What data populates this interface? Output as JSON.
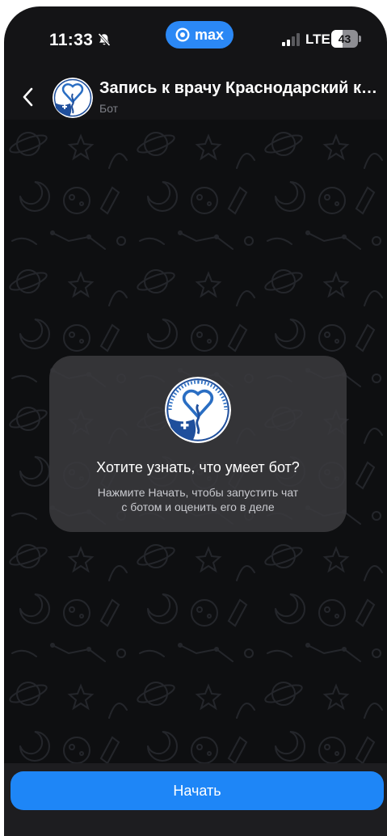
{
  "status_bar": {
    "time": "11:33",
    "bell_icon": "bell-slash-icon",
    "app_pill_label": "max",
    "app_pill_icon": "max-logo-icon",
    "network": "LTE",
    "battery": "43",
    "battery_level_percent": 43
  },
  "header": {
    "back_icon": "chevron-left-icon",
    "title": "Запись к врачу Краснодарский край",
    "subtitle": "Бот"
  },
  "intro_card": {
    "logo_icon": "ministry-health-logo",
    "title": "Хотите узнать, что умеет бот?",
    "text_line1": "Нажмите Начать, чтобы запустить чат",
    "text_line2": "с ботом и оценить его в деле"
  },
  "footer": {
    "start_button_label": "Начать"
  },
  "colors": {
    "accent": "#1e86f7",
    "pill": "#2b88f5",
    "background": "#141416",
    "card": "#3a3a3e"
  }
}
